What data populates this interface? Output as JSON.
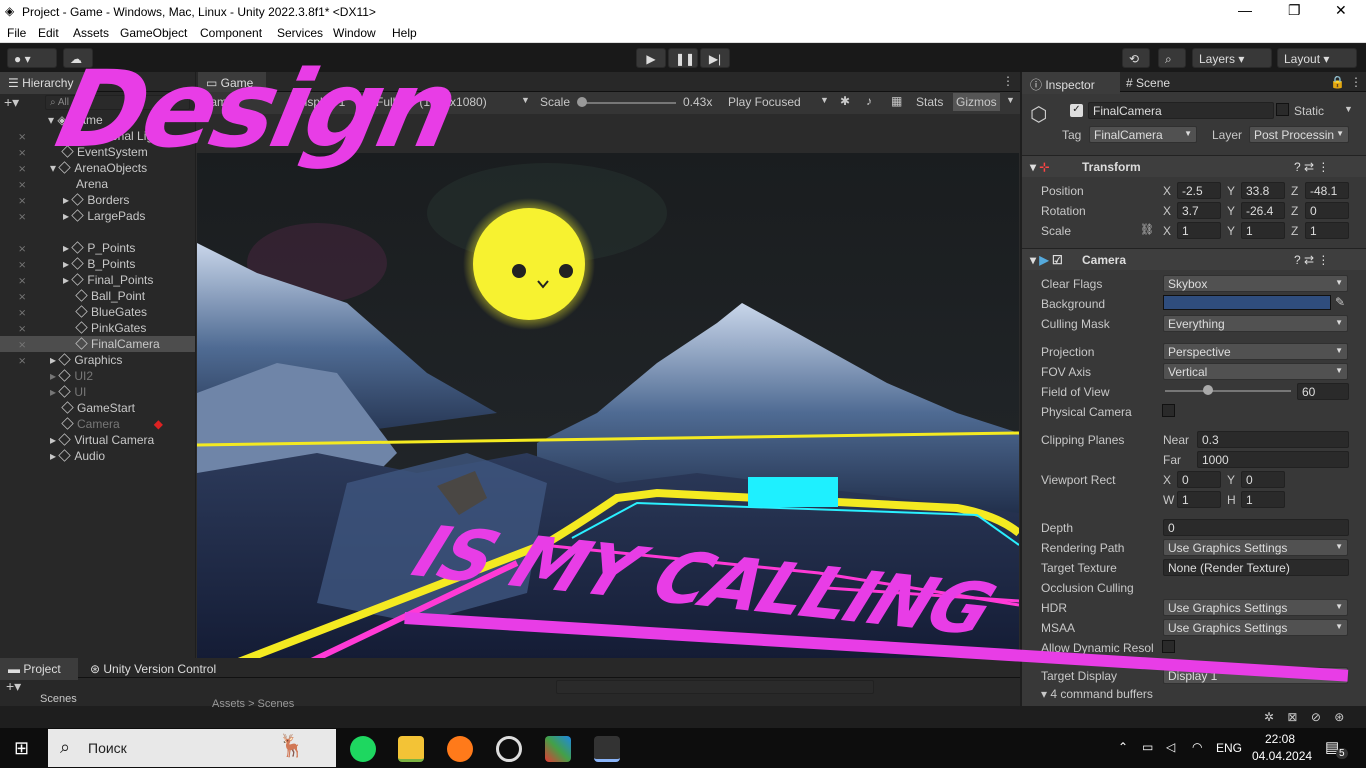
{
  "window": {
    "title": "Project - Game - Windows, Mac, Linux - Unity 2022.3.8f1* <DX11>"
  },
  "menu": [
    "File",
    "Edit",
    "Assets",
    "GameObject",
    "Component",
    "Services",
    "Window",
    "Help"
  ],
  "toolbar": {
    "layers": "Layers",
    "layout": "Layout"
  },
  "hierarchy": {
    "tab": "Hierarchy",
    "search_placeholder": "All",
    "scene": "Game",
    "items": [
      "Directional Light",
      "EventSystem",
      "ArenaObjects",
      "Arena",
      "Borders",
      "LargePads",
      "P_Points",
      "B_Points",
      "Final_Points",
      "Ball_Point",
      "BlueGates",
      "PinkGates",
      "FinalCamera",
      "Graphics",
      "UI2",
      "UI",
      "GameStart",
      "Camera",
      "Virtual Camera",
      "Audio"
    ]
  },
  "game": {
    "tab": "Game",
    "display_dd": "Game",
    "display": "Display 1",
    "resolution": "Full HD (1920x1080)",
    "scale_label": "Scale",
    "scale_value": "0.43x",
    "play_focused": "Play Focused",
    "stats": "Stats",
    "gizmos": "Gizmos"
  },
  "inspector": {
    "tab_inspector": "Inspector",
    "tab_scene": "Scene",
    "object_name": "FinalCamera",
    "static": "Static",
    "tag_label": "Tag",
    "tag": "FinalCamera",
    "layer_label": "Layer",
    "layer": "Post Processin",
    "transform": {
      "title": "Transform",
      "position": "Position",
      "rotation": "Rotation",
      "scale": "Scale",
      "pos": [
        "-2.5",
        "33.8",
        "-48.1"
      ],
      "rot": [
        "3.7",
        "-26.4",
        "0"
      ],
      "scl": [
        "1",
        "1",
        "1"
      ]
    },
    "camera": {
      "title": "Camera",
      "clear_flags": "Clear Flags",
      "clear_flags_v": "Skybox",
      "background": "Background",
      "culling_mask": "Culling Mask",
      "culling_mask_v": "Everything",
      "projection": "Projection",
      "projection_v": "Perspective",
      "fov_axis": "FOV Axis",
      "fov_axis_v": "Vertical",
      "fov": "Field of View",
      "fov_v": "60",
      "physical": "Physical Camera",
      "clipping": "Clipping Planes",
      "near": "Near",
      "near_v": "0.3",
      "far": "Far",
      "far_v": "1000",
      "viewport": "Viewport Rect",
      "vx": "0",
      "vy": "0",
      "vw": "1",
      "vh": "1",
      "depth": "Depth",
      "depth_v": "0",
      "rendering": "Rendering Path",
      "rendering_v": "Use Graphics Settings",
      "target_texture": "Target Texture",
      "target_texture_v": "None (Render Texture)",
      "occlusion": "Occlusion Culling",
      "hdr": "HDR",
      "hdr_v": "Use Graphics Settings",
      "msaa": "MSAA",
      "msaa_v": "Use Graphics Settings",
      "dynres": "Allow Dynamic Resol",
      "target_display": "Target Display",
      "target_display_v": "Display 1",
      "cmd": "4 command buffers"
    }
  },
  "project": {
    "tab_project": "Project",
    "tab_uvc": "Unity Version Control",
    "scenes": "Scenes",
    "breadcrumb": "Assets > Scenes"
  },
  "overlay": {
    "line1": "Design",
    "line2": "IS MY CALLING"
  },
  "taskbar": {
    "search": "Поиск",
    "lang": "ENG",
    "time": "22:08",
    "date": "04.04.2024",
    "notif": "5"
  }
}
